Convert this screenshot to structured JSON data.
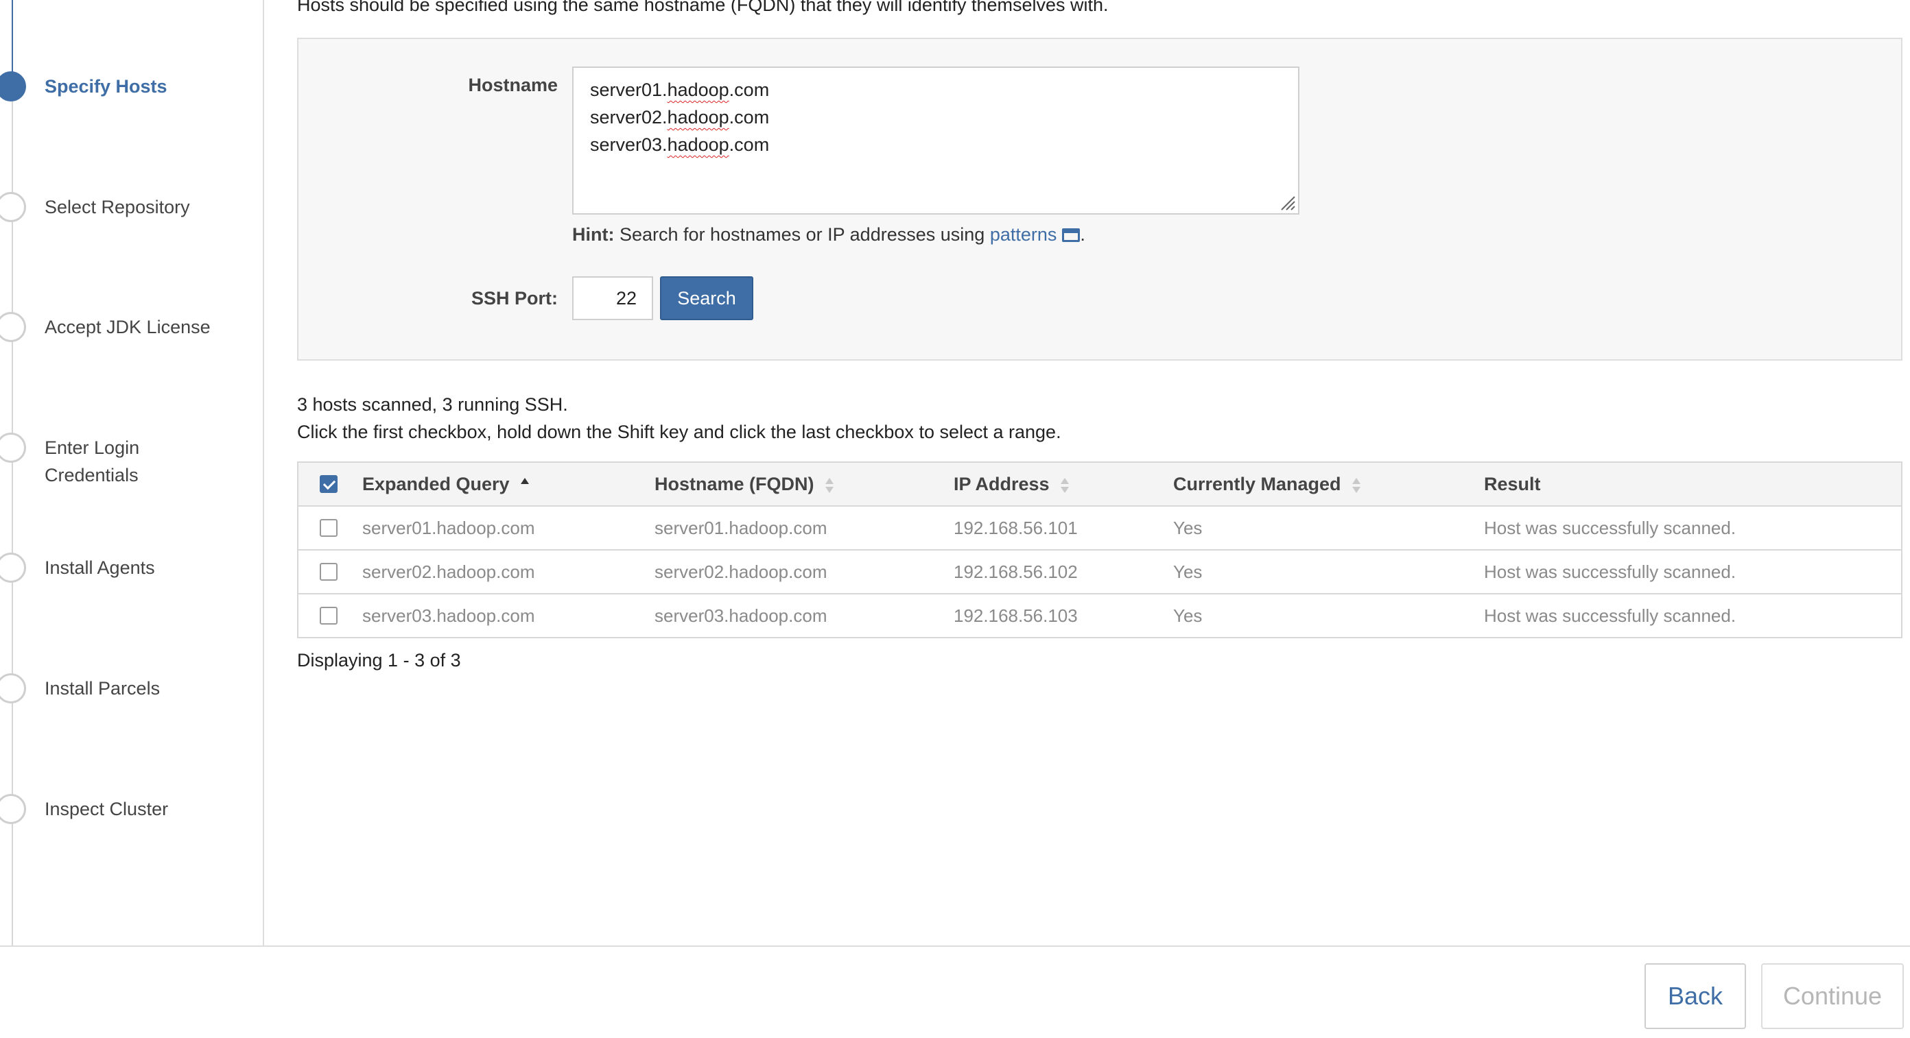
{
  "intro": "Hosts should be specified using the same hostname (FQDN) that they will identify themselves with.",
  "steps": [
    {
      "label": "Specify Hosts",
      "active": true
    },
    {
      "label": "Select Repository",
      "active": false
    },
    {
      "label": "Accept JDK License",
      "active": false
    },
    {
      "label": "Enter Login Credentials",
      "active": false
    },
    {
      "label": "Install Agents",
      "active": false
    },
    {
      "label": "Install Parcels",
      "active": false
    },
    {
      "label": "Inspect Cluster",
      "active": false
    }
  ],
  "form": {
    "hostname_label": "Hostname",
    "hostname_lines": [
      {
        "pre": "server01.",
        "marked": "hadoop",
        "post": ".com"
      },
      {
        "pre": "server02.",
        "marked": "hadoop",
        "post": ".com"
      },
      {
        "pre": "server03.",
        "marked": "hadoop",
        "post": ".com"
      }
    ],
    "hint_bold": "Hint:",
    "hint_text": "Search for hostnames or IP addresses using",
    "hint_link": "patterns",
    "hint_end": ".",
    "ssh_port_label": "SSH Port:",
    "ssh_port_value": "22",
    "search_label": "Search"
  },
  "summary": {
    "line1": "3 hosts scanned, 3 running SSH.",
    "line2": "Click the first checkbox, hold down the Shift key and click the last checkbox to select a range."
  },
  "table": {
    "columns": [
      "Expanded Query",
      "Hostname (FQDN)",
      "IP Address",
      "Currently Managed",
      "Result"
    ],
    "header_checked": true,
    "rows": [
      {
        "checked": false,
        "query": "server01.hadoop.com",
        "fqdn": "server01.hadoop.com",
        "ip": "192.168.56.101",
        "managed": "Yes",
        "result": "Host was successfully scanned."
      },
      {
        "checked": false,
        "query": "server02.hadoop.com",
        "fqdn": "server02.hadoop.com",
        "ip": "192.168.56.102",
        "managed": "Yes",
        "result": "Host was successfully scanned."
      },
      {
        "checked": false,
        "query": "server03.hadoop.com",
        "fqdn": "server03.hadoop.com",
        "ip": "192.168.56.103",
        "managed": "Yes",
        "result": "Host was successfully scanned."
      }
    ],
    "display_count": "Displaying 1 - 3 of 3"
  },
  "footer": {
    "back_label": "Back",
    "continue_label": "Continue"
  },
  "colors": {
    "accent": "#3f6ea6",
    "muted_text": "#8a8a8a",
    "spellcheck": "#d22222"
  }
}
